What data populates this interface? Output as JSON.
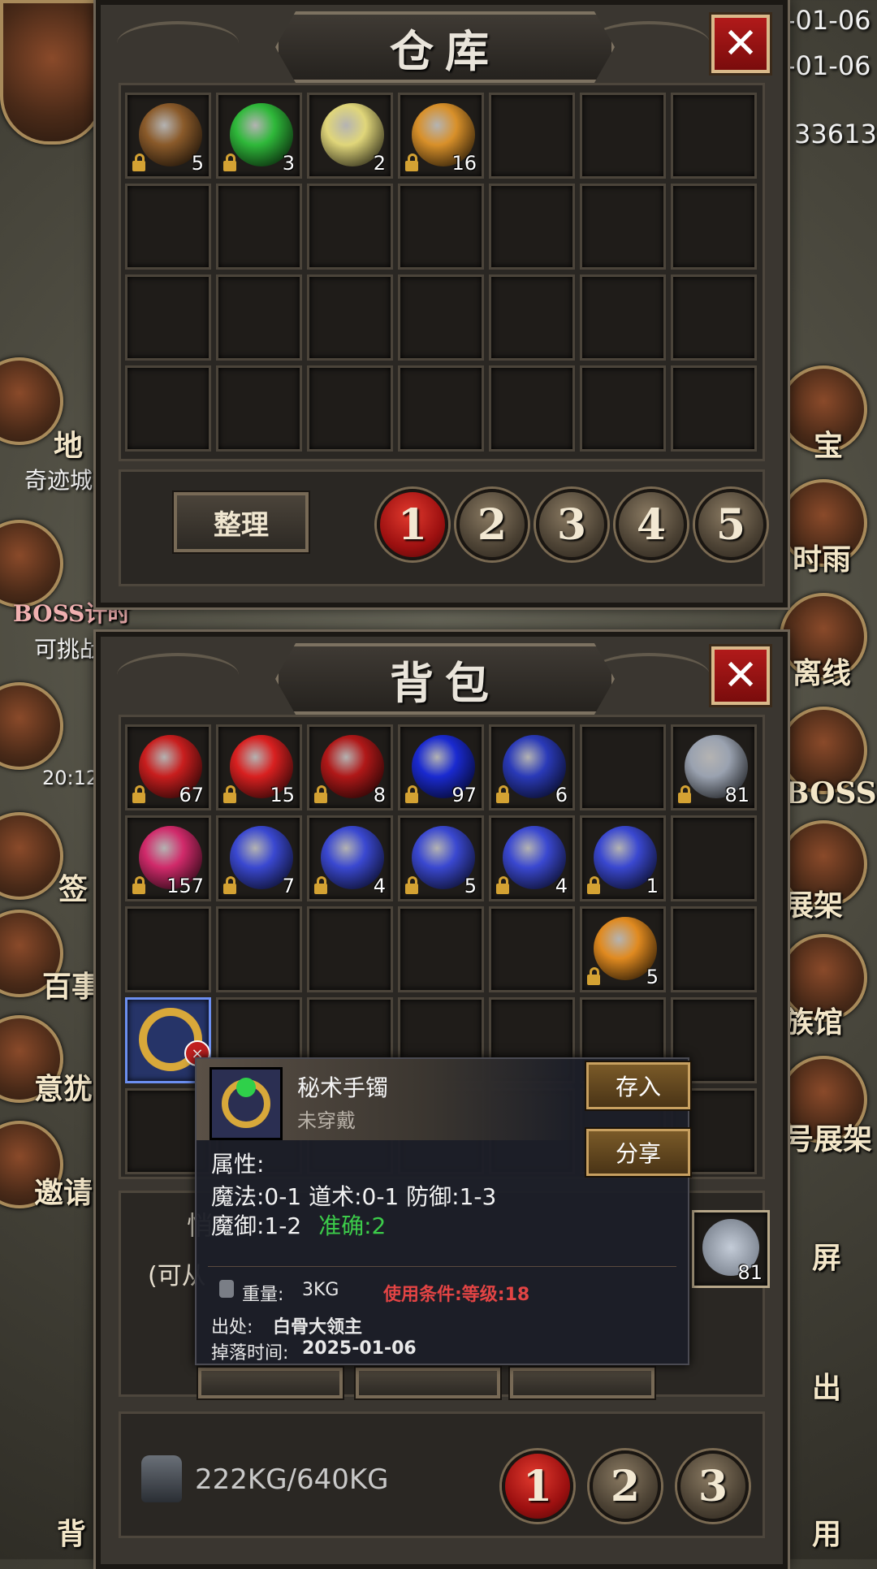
{
  "hud": {
    "date_1": "-01-06",
    "date_2": "-01-06",
    "id_partial": "33613",
    "left_labels": [
      "地",
      "奇迹城",
      "BOSS计时",
      "可挑战",
      "20:12",
      "签",
      "百事",
      "意犹",
      "邀请"
    ],
    "right_labels": [
      "宝",
      "时雨",
      "离线",
      "BOSS",
      "展架",
      "族馆",
      "号展架",
      "屏",
      "出",
      "用"
    ],
    "bottom_left": "背"
  },
  "warehouse": {
    "title": "仓库",
    "close_icon": "close-icon",
    "items": [
      {
        "icon": "ore-icon",
        "color": "#8a5a2a",
        "locked": true,
        "count": "5"
      },
      {
        "icon": "jade-orb-icon",
        "color": "#2fb83a",
        "locked": true,
        "count": "3"
      },
      {
        "icon": "pouch-icon",
        "color": "#e0d67a",
        "locked": false,
        "count": "2"
      },
      {
        "icon": "potion-gold-icon",
        "color": "#d8902a",
        "locked": true,
        "count": "16"
      }
    ],
    "sort_label": "整理",
    "pages": [
      "1",
      "2",
      "3",
      "4",
      "5"
    ],
    "active_page": 1
  },
  "backpack": {
    "title": "背包",
    "close_icon": "close-icon",
    "row1": [
      {
        "icon": "red-potion-small-icon",
        "color": "#c81e1e",
        "locked": true,
        "count": "67"
      },
      {
        "icon": "red-potion-large-icon",
        "color": "#d82020",
        "locked": true,
        "count": "15"
      },
      {
        "icon": "red-round-potion-icon",
        "color": "#b01818",
        "locked": true,
        "count": "8"
      },
      {
        "icon": "blue-potion-large-icon",
        "color": "#1a2ad0",
        "locked": true,
        "count": "97"
      },
      {
        "icon": "blue-round-potion-icon",
        "color": "#2a3ab8",
        "locked": true,
        "count": "6"
      },
      {
        "icon": "",
        "color": "",
        "locked": false,
        "count": ""
      },
      {
        "icon": "iron-ore-icon",
        "color": "#9aa2b0",
        "locked": true,
        "count": "81"
      }
    ],
    "row2": [
      {
        "icon": "scroll-icon",
        "color": "#d02a6a",
        "locked": true,
        "count": "157"
      },
      {
        "icon": "skill-book-icon",
        "color": "#3a48d0",
        "locked": true,
        "count": "7"
      },
      {
        "icon": "skill-book-icon",
        "color": "#3a48d0",
        "locked": true,
        "count": "4"
      },
      {
        "icon": "skill-book-icon",
        "color": "#3a48d0",
        "locked": true,
        "count": "5"
      },
      {
        "icon": "skill-book-icon",
        "color": "#3a48d0",
        "locked": true,
        "count": "4"
      },
      {
        "icon": "skill-book-icon",
        "color": "#3a48d0",
        "locked": true,
        "count": "1"
      },
      {
        "icon": "",
        "color": "",
        "locked": false,
        "count": ""
      }
    ],
    "row3_item": {
      "icon": "potion-gold-icon",
      "color": "#e08a20",
      "locked": true,
      "count": "5"
    },
    "selected_item": {
      "icon": "bracelet-icon",
      "color": "#d8a83a"
    },
    "obscured_text": "(可从",
    "obscured_char": "悄",
    "weight_icon": "weight-icon",
    "weight": "222KG/640KG",
    "pages": [
      "1",
      "2",
      "3"
    ],
    "active_page": 1,
    "right_slot_count": "81"
  },
  "tooltip": {
    "name": "秘术手镯",
    "status": "未穿戴",
    "store_label": "存入",
    "share_label": "分享",
    "attr_title": "属性:",
    "attr_line1": "魔法:0-1  道术:0-1  防御:1-3",
    "attr_line2_a": "魔御:1-2",
    "attr_line2_b": "准确:2",
    "weight_label": "重量:",
    "weight_value": "3KG",
    "requirement": "使用条件:等级:18",
    "source_label": "出处:",
    "source_value": "白骨大领主",
    "drop_label": "掉落时间:",
    "drop_value": "2025-01-06"
  }
}
